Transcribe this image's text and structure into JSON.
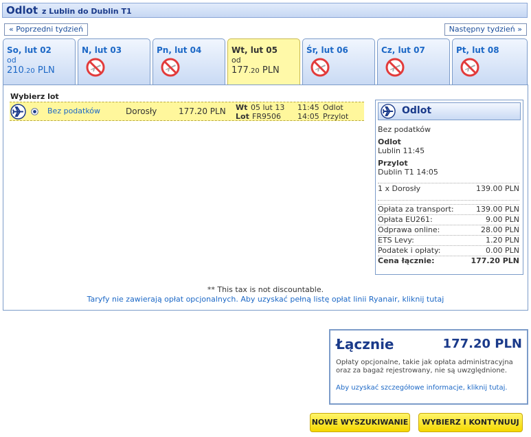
{
  "header": {
    "title": "Odlot",
    "subtitle": "z Lublin do Dublin T1"
  },
  "nav": {
    "prev_label": "« Poprzedni tydzień",
    "next_label": "Następny tydzień »"
  },
  "days": [
    {
      "name": "So, lut 02",
      "from": "od",
      "price_int": "210",
      "price_dec": ".20",
      "currency": " PLN",
      "available": true,
      "selected": false
    },
    {
      "name": "N, lut 03",
      "available": false
    },
    {
      "name": "Pn, lut 04",
      "available": false
    },
    {
      "name": "Wt, lut 05",
      "from": "od",
      "price_int": "177",
      "price_dec": ".20",
      "currency": " PLN",
      "available": true,
      "selected": true
    },
    {
      "name": "Śr, lut 06",
      "available": false
    },
    {
      "name": "Cz, lut 07",
      "available": false
    },
    {
      "name": "Pt, lut 08",
      "available": false
    }
  ],
  "flights": {
    "heading": "Wybierz lot",
    "row": {
      "fare": "Bez podatków",
      "passenger": "Dorosły",
      "price": "177.20 PLN",
      "day_label": "Wt",
      "date": "05 lut 13",
      "flight_label": "Lot",
      "flight_no": "FR9506",
      "dep_time": "11:45",
      "dep_label": "Odlot",
      "arr_time": "14:05",
      "arr_label": "Przylot"
    }
  },
  "summary": {
    "title": "Odlot",
    "fare": "Bez podatków",
    "dep_heading": "Odlot",
    "dep_detail": "Lublin 11:45",
    "arr_heading": "Przylot",
    "arr_detail": "Dublin T1 14:05",
    "pax_label": "1 x Dorosły",
    "pax_value": "139.00 PLN",
    "fees": [
      {
        "label": "Opłata za transport:",
        "value": "139.00 PLN"
      },
      {
        "label": "Opłata EU261:",
        "value": "9.00 PLN"
      },
      {
        "label": "Odprawa online:",
        "value": "28.00 PLN"
      },
      {
        "label": "ETS Levy:",
        "value": "1.20 PLN"
      },
      {
        "label": "Podatek i opłaty:",
        "value": "0.00 PLN"
      }
    ],
    "total_label": "Cena łącznie:",
    "total_value": "177.20 PLN"
  },
  "notes": {
    "tax": "** This tax is not discountable.",
    "link": "Taryfy nie zawierają opłat opcjonalnych. Aby uzyskać pełną listę opłat linii Ryanair, kliknij tutaj"
  },
  "total": {
    "label": "Łącznie",
    "value": "177.20 PLN",
    "info": "Opłaty opcjonalne, takie jak opłata administracyjna oraz za bagaż rejestrowany, nie są uwzględnione.",
    "link": "Aby uzyskać szczegółowe informacje, kliknij tutaj."
  },
  "buttons": {
    "new_search": "NOWE WYSZUKIWANIE",
    "continue": "WYBIERZ I KONTYNUUJ"
  },
  "colors": {
    "accent": "#1a3a8a",
    "link": "#1c68c6",
    "selected_bg": "#fff9a8",
    "button": "#f5d800"
  }
}
